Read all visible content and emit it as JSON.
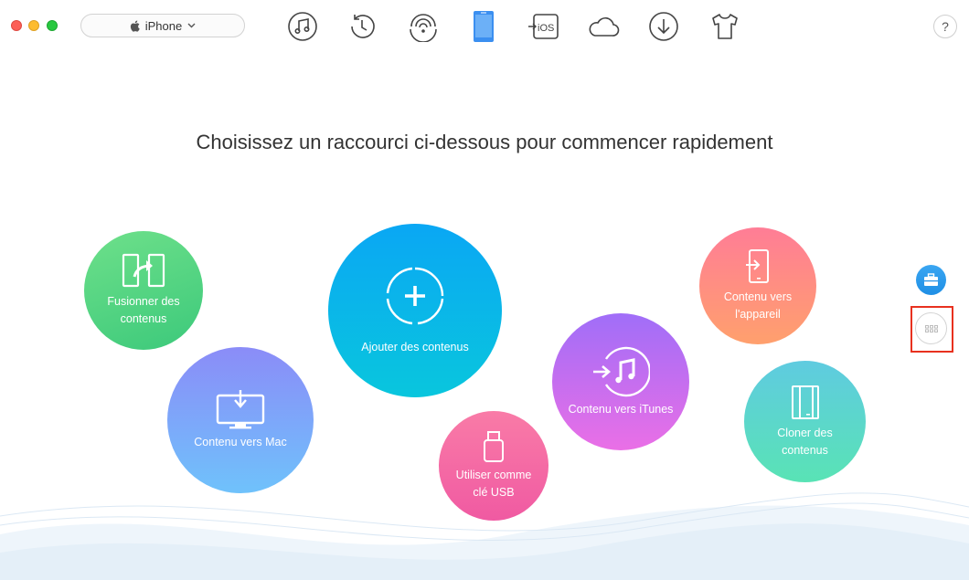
{
  "window": {
    "device_selector": {
      "label": "iPhone",
      "icon": "apple-icon",
      "chevron": "chevron-down-icon"
    },
    "toolbar": [
      {
        "name": "music-icon"
      },
      {
        "name": "history-icon"
      },
      {
        "name": "wifi-icon"
      },
      {
        "name": "device-icon",
        "active": true
      },
      {
        "name": "ios-mover-icon",
        "label": "iOS"
      },
      {
        "name": "cloud-icon"
      },
      {
        "name": "download-icon"
      },
      {
        "name": "tshirt-icon"
      }
    ],
    "help_label": "?"
  },
  "main": {
    "headline": "Choisissez un raccourci ci-dessous pour commencer rapidement",
    "shortcuts": {
      "merge": "Fusionner des contenus",
      "to_mac": "Contenu vers Mac",
      "add": "Ajouter des contenus",
      "usb": "Utiliser comme clé USB",
      "to_itunes": "Contenu vers iTunes",
      "to_device": "Contenu vers l'appareil",
      "clone": "Cloner des contenus"
    }
  },
  "side": {
    "toolbox_icon": "toolbox-icon",
    "grid_icon": "grid-icon"
  },
  "colors": {
    "accent": "#1e90e6",
    "active_tool": "#3b8ff0",
    "highlight_frame": "#e8311f"
  }
}
